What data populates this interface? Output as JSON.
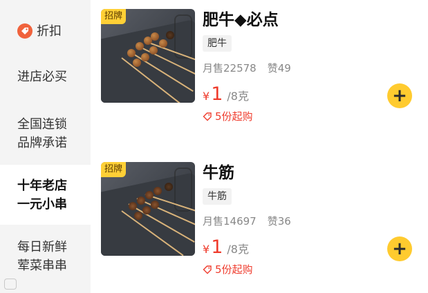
{
  "sidebar": {
    "items": [
      {
        "label_lines": [
          "折扣"
        ],
        "icon": "discount-icon"
      },
      {
        "label_lines": [
          "进店必买"
        ]
      },
      {
        "label_lines": [
          "全国连锁",
          "品牌承诺"
        ]
      },
      {
        "label_lines": [
          "十年老店",
          "一元小串"
        ],
        "active": true
      },
      {
        "label_lines": [
          "每日新鲜",
          "荤菜串串"
        ]
      }
    ]
  },
  "products": [
    {
      "badge": "招牌",
      "name": "肥牛◆必点",
      "tag": "肥牛",
      "monthly_sales": "月售22578",
      "likes": "赞49",
      "currency": "¥",
      "price": "1",
      "unit": "/8克",
      "min_order": "5份起购"
    },
    {
      "badge": "招牌",
      "name": "牛筋",
      "tag": "牛筋",
      "monthly_sales": "月售14697",
      "likes": "赞36",
      "currency": "¥",
      "price": "1",
      "unit": "/8克",
      "min_order": "5份起购"
    }
  ],
  "add_button_icon": "plus-icon",
  "colors": {
    "accent_yellow": "#ffcb2f",
    "price_red": "#ef3b2c",
    "sidebar_bg": "#f4f4f4"
  }
}
